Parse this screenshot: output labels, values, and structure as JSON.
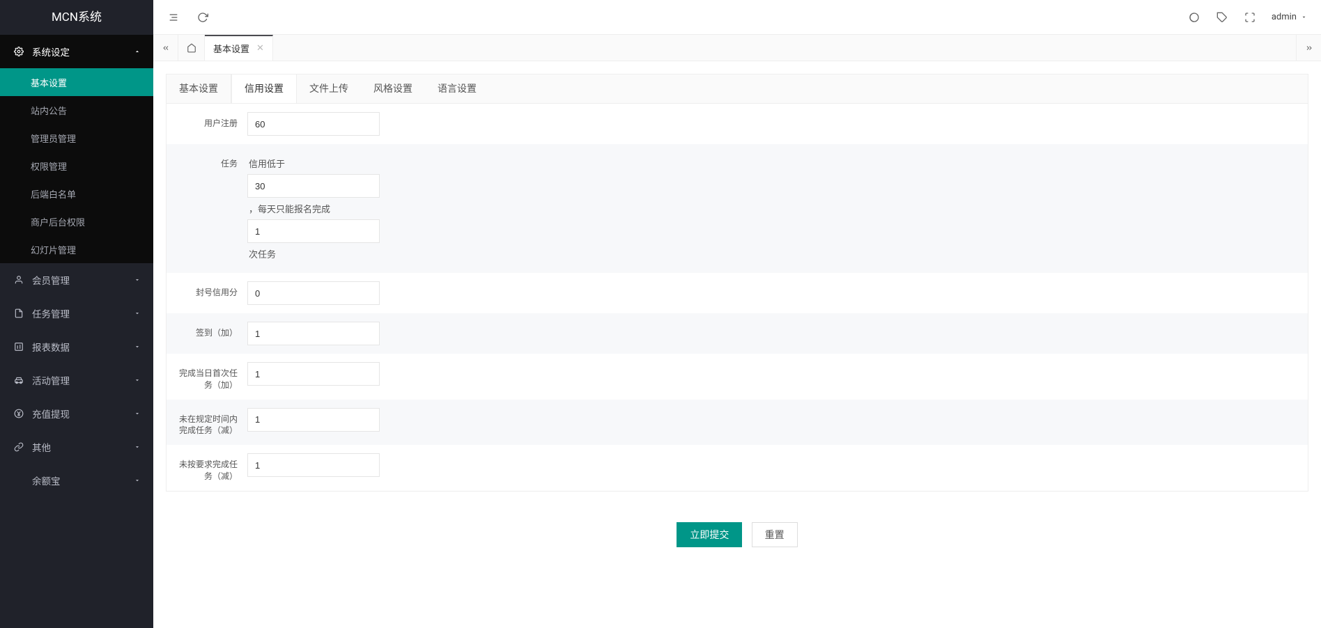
{
  "app_title": "MCN系统",
  "header": {
    "user": "admin"
  },
  "sidebar": {
    "system_settings": {
      "label": "系统设定",
      "children": [
        {
          "label": "基本设置",
          "key": "basic",
          "active": true
        },
        {
          "label": "站内公告",
          "key": "announce"
        },
        {
          "label": "管理员管理",
          "key": "admin-manage"
        },
        {
          "label": "权限管理",
          "key": "perm"
        },
        {
          "label": "后端白名单",
          "key": "whitelist"
        },
        {
          "label": "商户后台权限",
          "key": "merchant-perm"
        },
        {
          "label": "幻灯片管理",
          "key": "slideshow"
        }
      ]
    },
    "menus": [
      {
        "label": "会员管理",
        "icon": "user",
        "key": "member"
      },
      {
        "label": "任务管理",
        "icon": "doc",
        "key": "task"
      },
      {
        "label": "报表数据",
        "icon": "chart",
        "key": "report"
      },
      {
        "label": "活动管理",
        "icon": "car",
        "key": "activity"
      },
      {
        "label": "充值提现",
        "icon": "yen",
        "key": "recharge"
      },
      {
        "label": "其他",
        "icon": "link",
        "key": "other"
      },
      {
        "label": "余额宝",
        "icon": "",
        "key": "yuebao"
      }
    ]
  },
  "tabbar": {
    "current": "基本设置"
  },
  "inner_tabs": [
    {
      "label": "基本设置",
      "key": "basic"
    },
    {
      "label": "信用设置",
      "key": "credit",
      "active": true
    },
    {
      "label": "文件上传",
      "key": "upload"
    },
    {
      "label": "风格设置",
      "key": "style"
    },
    {
      "label": "语言设置",
      "key": "lang"
    }
  ],
  "form": {
    "user_register": {
      "label": "用户注册",
      "value": "60"
    },
    "task": {
      "label": "任务",
      "text_below": "信用低于",
      "v1": "30",
      "text_mid": "，每天只能报名完成",
      "v2": "1",
      "text_tail": "次任务"
    },
    "ban_credit": {
      "label": "封号信用分",
      "value": "0"
    },
    "checkin_add": {
      "label": "签到（加）",
      "value": "1"
    },
    "first_task_add": {
      "label": "完成当日首次任务（加）",
      "value": "1"
    },
    "overdue_sub": {
      "label": "未在规定时间内完成任务（减）",
      "value": "1"
    },
    "requirement_sub": {
      "label": "未按要求完成任务（减）",
      "value": "1"
    }
  },
  "buttons": {
    "submit": "立即提交",
    "reset": "重置"
  }
}
